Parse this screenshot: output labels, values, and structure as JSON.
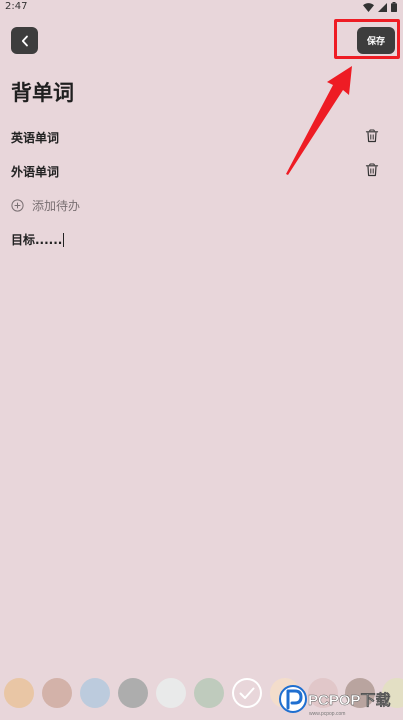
{
  "status_bar": {
    "time": "2:47"
  },
  "header": {
    "back_icon": "chevron-left-icon",
    "save_label": "保存"
  },
  "page": {
    "title": "背单词"
  },
  "todo_items": [
    {
      "text": "英语单词"
    },
    {
      "text": "外语单词"
    }
  ],
  "add_todo": {
    "label": "添加待办",
    "icon": "plus-circle-icon"
  },
  "goal": {
    "text": "目标......"
  },
  "palette": {
    "colors": [
      "#e9c6a5",
      "#d3b2a9",
      "#bccbdd",
      "#adadad",
      "#e9eaea",
      "#bfcbbd",
      "#e8d6da",
      "#f3ddcb",
      "#e1c7c9",
      "#b9a49f",
      "#e3dfc4"
    ],
    "selected_index": 6
  },
  "watermark": {
    "text": "PCPOP下载",
    "subtext": "www.pcpop.com"
  },
  "colors": {
    "background": "#e8d6da",
    "button": "#3d3d3d",
    "annotation": "#ee1c24"
  }
}
